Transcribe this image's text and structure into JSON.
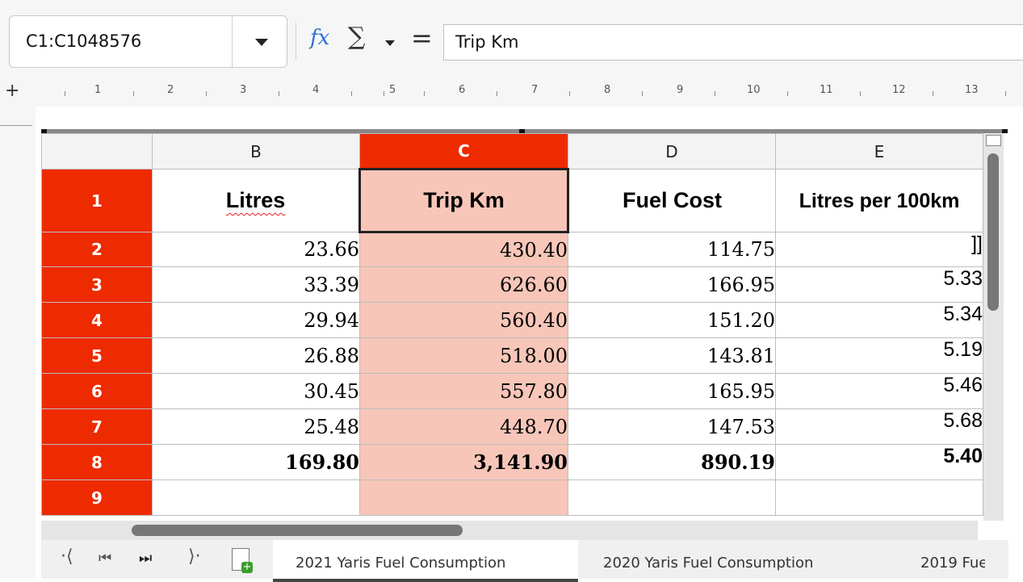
{
  "namebox": {
    "value": "C1:C1048576"
  },
  "formula_bar": {
    "fx_icon": "𝑓x",
    "sum_icon": "∑",
    "equals_icon": "=",
    "content": "Trip Km"
  },
  "ruler": {
    "labels": [
      "1",
      "2",
      "3",
      "4",
      "5",
      "6",
      "7",
      "8",
      "9",
      "10",
      "11",
      "12",
      "13"
    ],
    "plus": "+"
  },
  "columns": [
    "B",
    "C",
    "D",
    "E"
  ],
  "selected_column": "C",
  "rows": [
    "1",
    "2",
    "3",
    "4",
    "5",
    "6",
    "7",
    "8",
    "9"
  ],
  "headers": {
    "litres": "Litres",
    "trip_km": "Trip Km",
    "fuel_cost": "Fuel Cost",
    "litres_per_100km": "Litres per 100km"
  },
  "data_rows": [
    {
      "b": "23.66",
      "c": "430.40",
      "d": "114.75",
      "e": "]]"
    },
    {
      "b": "33.39",
      "c": "626.60",
      "d": "166.95",
      "e": "5.33"
    },
    {
      "b": "29.94",
      "c": "560.40",
      "d": "151.20",
      "e": "5.34"
    },
    {
      "b": "26.88",
      "c": "518.00",
      "d": "143.81",
      "e": "5.19"
    },
    {
      "b": "30.45",
      "c": "557.80",
      "d": "165.95",
      "e": "5.46"
    },
    {
      "b": "25.48",
      "c": "448.70",
      "d": "147.53",
      "e": "5.68"
    }
  ],
  "totals": {
    "b": "169.80",
    "c": "3,141.90",
    "d": "890.19",
    "e": "5.40"
  },
  "sheet_tabs": [
    "2021 Yaris Fuel Consumption",
    "2020 Yaris Fuel Consumption",
    "2019 Fue"
  ],
  "colors": {
    "accent": "#ee2a00",
    "selected_fill": "#f7c6b9",
    "fx_blue": "#2a6fd6"
  }
}
